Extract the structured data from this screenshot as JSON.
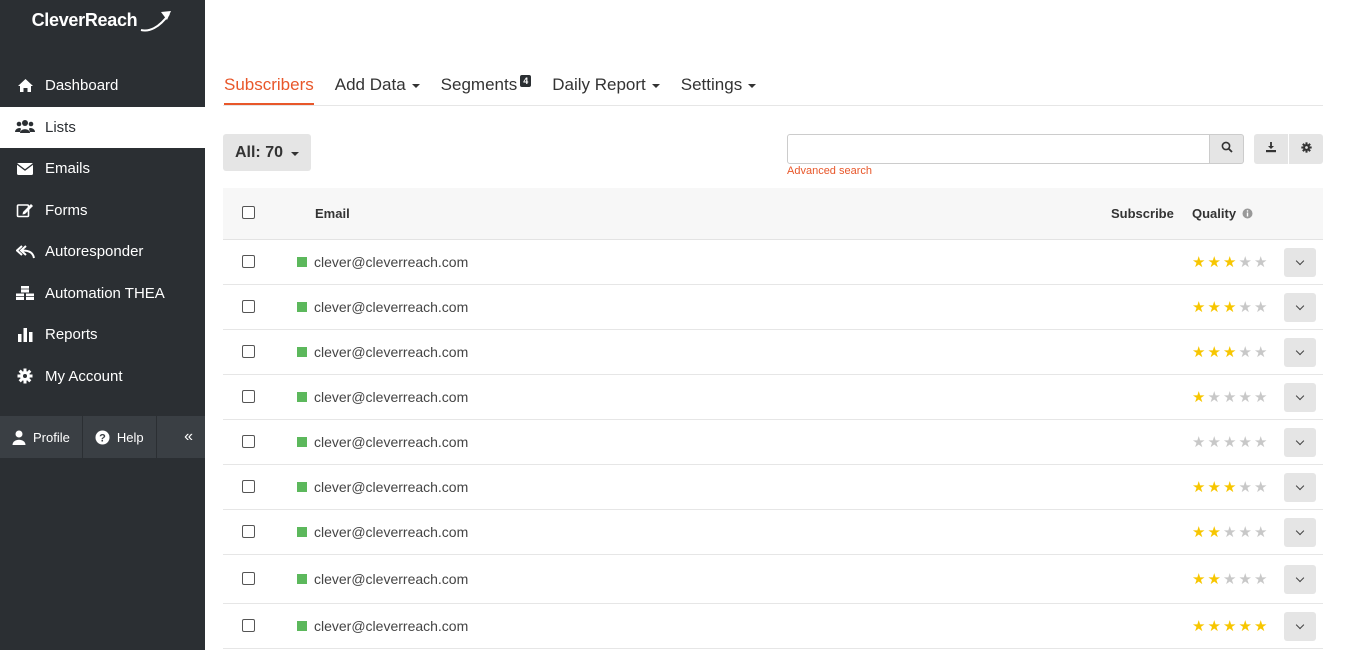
{
  "app": {
    "logo_text": "CleverReach"
  },
  "sidebar": {
    "items": [
      {
        "label": "Dashboard",
        "icon": "home-icon"
      },
      {
        "label": "Lists",
        "icon": "users-icon",
        "active": true
      },
      {
        "label": "Emails",
        "icon": "envelope-icon"
      },
      {
        "label": "Forms",
        "icon": "edit-icon"
      },
      {
        "label": "Autoresponder",
        "icon": "reply-all-icon"
      },
      {
        "label": "Automation THEA",
        "icon": "cubes-icon"
      },
      {
        "label": "Reports",
        "icon": "bar-chart-icon"
      },
      {
        "label": "My Account",
        "icon": "gear-icon"
      }
    ],
    "bottom": {
      "profile_label": "Profile",
      "help_label": "Help",
      "collapse_glyph": "«"
    }
  },
  "tabs": [
    {
      "label": "Subscribers",
      "active": true
    },
    {
      "label": "Add Data",
      "dropdown": true
    },
    {
      "label": "Segments",
      "badge": "4"
    },
    {
      "label": "Daily Report",
      "dropdown": true
    },
    {
      "label": "Settings",
      "dropdown": true
    }
  ],
  "filter": {
    "label": "All: 70"
  },
  "search": {
    "value": "",
    "placeholder": "",
    "advanced_label": "Advanced search"
  },
  "table": {
    "headers": {
      "email": "Email",
      "subscribe": "Subscribe",
      "quality": "Quality"
    },
    "rows": [
      {
        "email": "clever@cleverreach.com",
        "quality": 3
      },
      {
        "email": "clever@cleverreach.com",
        "quality": 3
      },
      {
        "email": "clever@cleverreach.com",
        "quality": 3
      },
      {
        "email": "clever@cleverreach.com",
        "quality": 1
      },
      {
        "email": "clever@cleverreach.com",
        "quality": 0
      },
      {
        "email": "clever@cleverreach.com",
        "quality": 3
      },
      {
        "email": "clever@cleverreach.com",
        "quality": 2
      },
      {
        "email": "clever@cleverreach.com",
        "quality": 2
      },
      {
        "email": "clever@cleverreach.com",
        "quality": 5
      }
    ]
  },
  "colors": {
    "accent": "#e8572a",
    "sidebar_bg": "#2b2f33",
    "status_active": "#5cb85c",
    "star": "#f7c600"
  }
}
